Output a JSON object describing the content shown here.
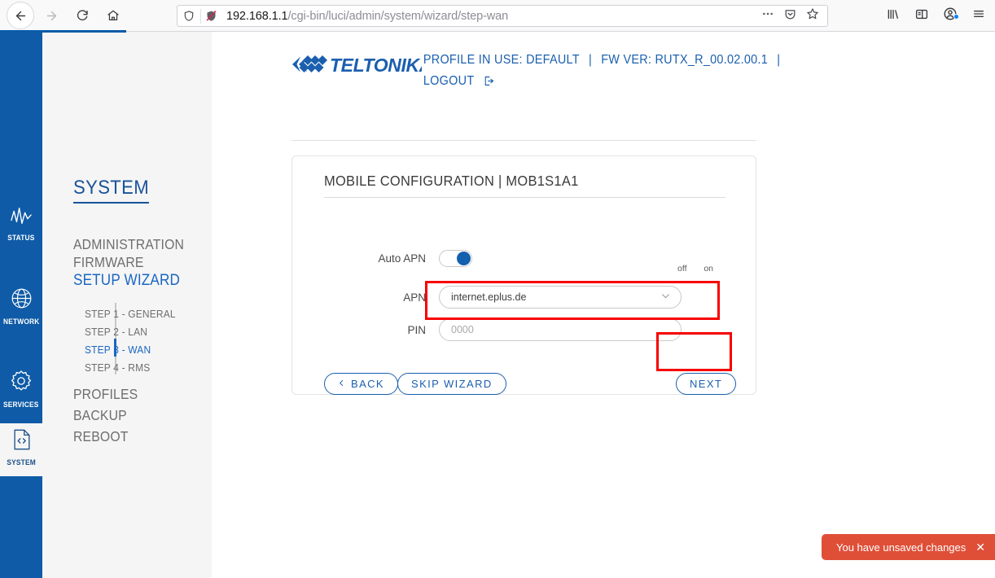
{
  "browser": {
    "back_icon": "arrow-left-icon",
    "forward_icon": "arrow-right-icon",
    "reload_icon": "reload-icon",
    "home_icon": "home-icon",
    "shield_icon": "shield-icon",
    "tracker_icon": "tracker-protection-icon",
    "url_host": "192.168.1.1",
    "url_path": "/cgi-bin/luci/admin/system/wizard/step-wan",
    "page_actions_icon": "ellipsis-icon",
    "pocket_icon": "pocket-save-icon",
    "bookmark_icon": "star-icon",
    "library_icon": "library-icon",
    "sidebar_icon": "sidebar-icon",
    "account_icon": "account-icon",
    "menu_icon": "hamburger-menu-icon"
  },
  "rail": {
    "items": [
      {
        "label": "STATUS",
        "icon": "status-graph-icon",
        "active": false
      },
      {
        "label": "NETWORK",
        "icon": "globe-icon",
        "active": false
      },
      {
        "label": "SERVICES",
        "icon": "gear-icon",
        "active": false
      },
      {
        "label": "SYSTEM",
        "icon": "code-file-icon",
        "active": true
      }
    ]
  },
  "menu": {
    "title": "SYSTEM",
    "items": [
      {
        "label": "ADMINISTRATION",
        "active": false
      },
      {
        "label": "FIRMWARE",
        "active": false
      },
      {
        "label": "SETUP WIZARD",
        "active": true
      },
      {
        "label": "PROFILES",
        "active": false
      },
      {
        "label": "BACKUP",
        "active": false
      },
      {
        "label": "REBOOT",
        "active": false
      }
    ],
    "sub_items": [
      {
        "label": "STEP 1 - GENERAL",
        "active": false
      },
      {
        "label": "STEP 2 - LAN",
        "active": false
      },
      {
        "label": "STEP 3 - WAN",
        "active": true
      },
      {
        "label": "STEP 4 - RMS",
        "active": false
      }
    ]
  },
  "header": {
    "logo_text": "TELTONIKA",
    "logo_mark": "teltonika-chevron-logo",
    "profile_in_use": "PROFILE IN USE: DEFAULT",
    "separator": "|",
    "fw_ver": "FW VER: RUTX_R_00.02.00.1",
    "logout": "LOGOUT",
    "logout_icon": "logout-icon"
  },
  "card": {
    "title": "MOBILE CONFIGURATION | MOB1S1A1",
    "fields": {
      "auto_apn": {
        "label": "Auto APN",
        "state": "on",
        "off_label": "off",
        "on_label": "on"
      },
      "apn": {
        "label": "APN",
        "value": "internet.eplus.de",
        "chevron_icon": "chevron-down-icon"
      },
      "pin": {
        "label": "PIN",
        "value": "",
        "placeholder": "0000"
      }
    },
    "buttons": {
      "back": "BACK",
      "back_icon": "chevron-left-icon",
      "skip": "SKIP WIZARD",
      "next": "NEXT"
    }
  },
  "toast": {
    "message": "You have unsaved changes",
    "close_icon": "close-icon",
    "color": "#df4f38"
  },
  "colors": {
    "brand_blue": "#0f5ba7",
    "link_blue": "#1a66c2",
    "highlight_red": "#f70000",
    "rail_active_bg": "#f5f5f5",
    "menu_bg": "#f5f5f5"
  }
}
